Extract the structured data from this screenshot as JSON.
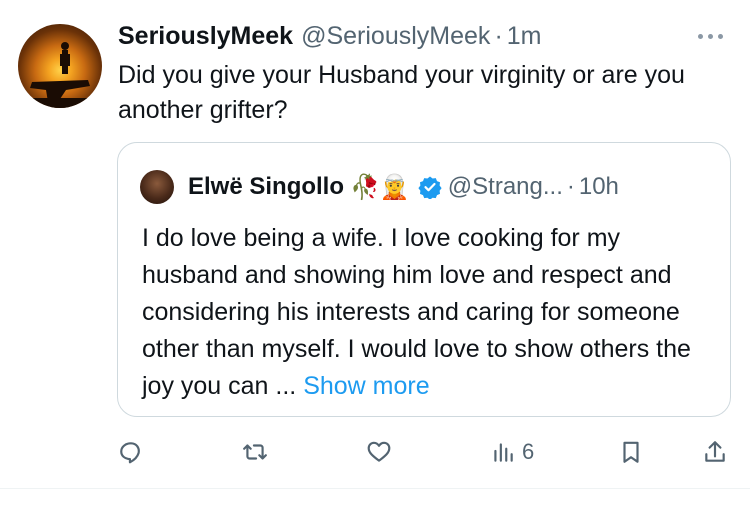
{
  "tweet": {
    "display_name": "SeriouslyMeek",
    "handle": "@SeriouslyMeek",
    "separator": "·",
    "time": "1m",
    "text": "Did you give your Husband your virginity or are you another grifter?"
  },
  "quoted": {
    "display_name": "Elwë Singollo",
    "emoji": "🥀🧝",
    "handle": "@Strang...",
    "separator": "·",
    "time": "10h",
    "text": "I do love being a wife. I love cooking for my husband and showing him love and respect and considering his interests and caring for someone other than myself. I would love to show others the joy you can ... ",
    "show_more": "Show more"
  },
  "actions": {
    "views_count": "6"
  },
  "colors": {
    "accent": "#1d9bf0",
    "secondary_text": "#536471",
    "border": "#cfd9de"
  },
  "icons": [
    "more-icon",
    "reply-icon",
    "retweet-icon",
    "like-icon",
    "views-icon",
    "bookmark-icon",
    "share-icon",
    "verified-badge-icon"
  ]
}
